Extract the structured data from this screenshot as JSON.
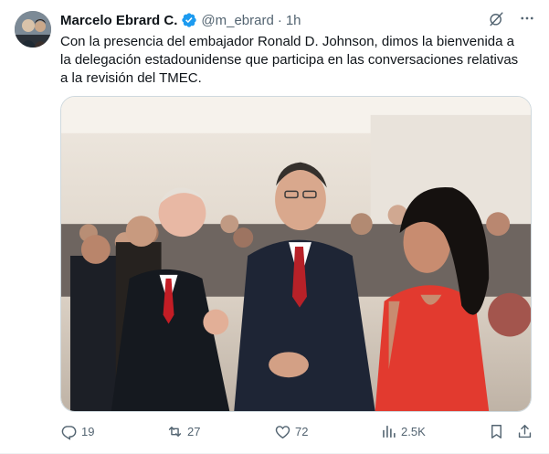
{
  "author": {
    "name": "Marcelo Ebrard C.",
    "handle": "@m_ebrard",
    "separator": "·",
    "time": "1h"
  },
  "tweet": {
    "text": "Con la presencia del embajador Ronald D. Johnson, dimos la bienvenida a\nla delegación estadounidense que participa en las conversaciones relativas\na la revisión del TMEC."
  },
  "icons": {
    "verified": "verified-badge-icon",
    "grok": "grok-icon",
    "more": "more-icon"
  },
  "actions": {
    "replies": "19",
    "reposts": "27",
    "likes": "72",
    "views": "2.5K"
  },
  "colors": {
    "text": "#0f1419",
    "muted": "#536471",
    "verified": "#1d9bf0",
    "border": "#cfd9de"
  }
}
